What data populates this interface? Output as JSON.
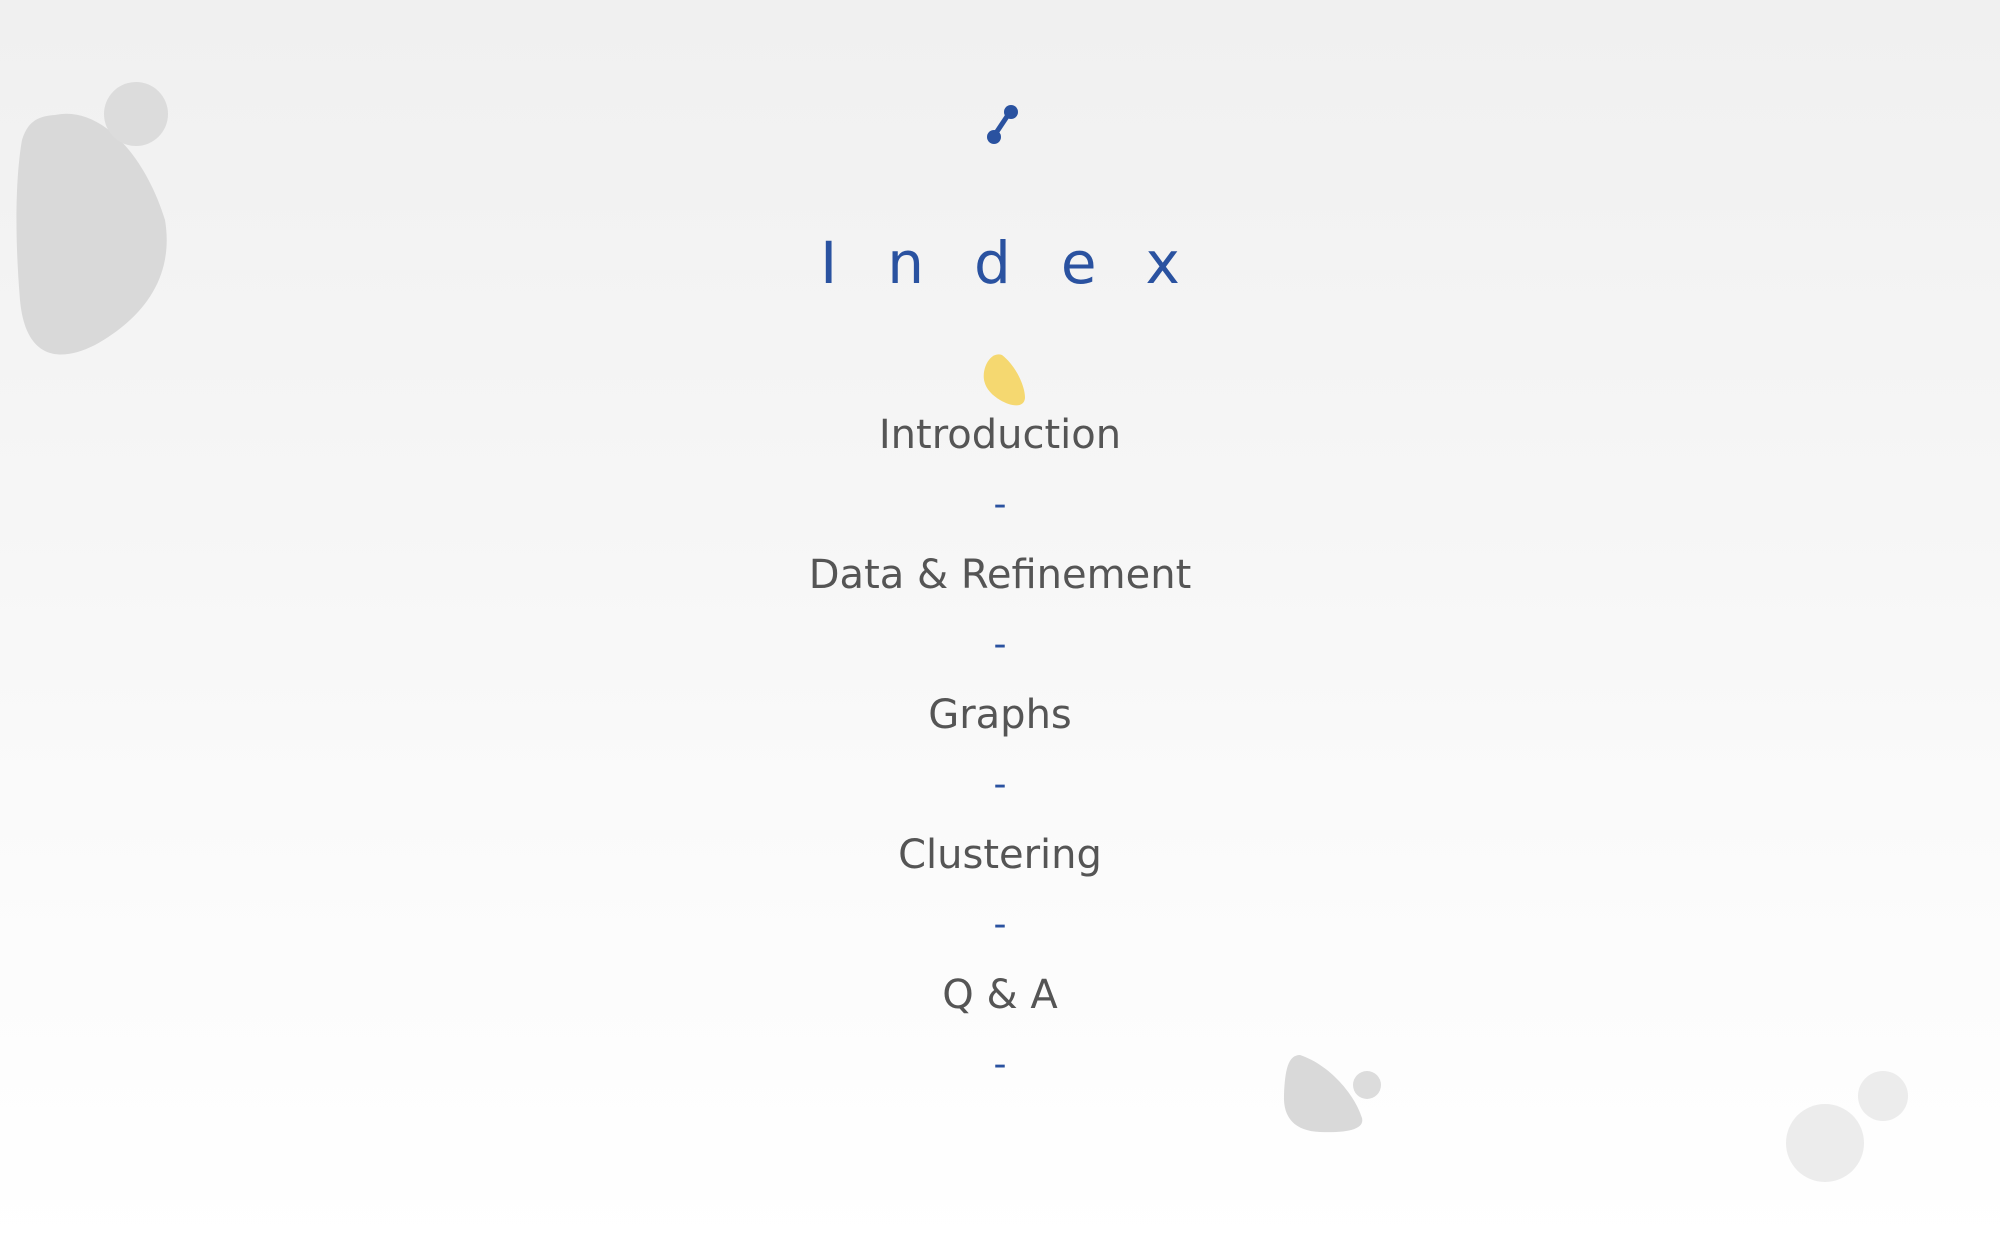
{
  "slide": {
    "title": "Index",
    "items": [
      {
        "label": "Introduction",
        "separator": "-"
      },
      {
        "label": "Data & Refinement",
        "separator": "-"
      },
      {
        "label": "Graphs",
        "separator": "-"
      },
      {
        "label": "Clustering",
        "separator": "-"
      },
      {
        "label": "Q & A",
        "separator": "-"
      }
    ]
  },
  "colors": {
    "accent": "#2a52a0",
    "text": "#555555",
    "decoration": "#d9d9d9",
    "highlight": "#f5d870"
  },
  "icons": {
    "title_icon": "node-link-icon",
    "highlight_icon": "yellow-drop-icon"
  }
}
